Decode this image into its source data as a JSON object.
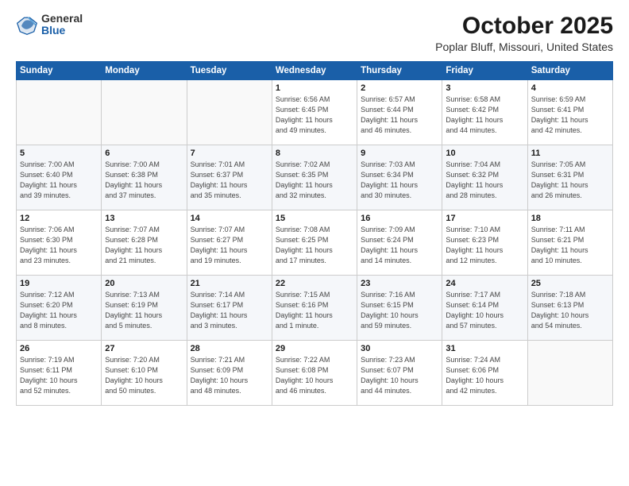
{
  "logo": {
    "general": "General",
    "blue": "Blue"
  },
  "title": "October 2025",
  "subtitle": "Poplar Bluff, Missouri, United States",
  "days_of_week": [
    "Sunday",
    "Monday",
    "Tuesday",
    "Wednesday",
    "Thursday",
    "Friday",
    "Saturday"
  ],
  "weeks": [
    [
      {
        "day": "",
        "info": ""
      },
      {
        "day": "",
        "info": ""
      },
      {
        "day": "",
        "info": ""
      },
      {
        "day": "1",
        "info": "Sunrise: 6:56 AM\nSunset: 6:45 PM\nDaylight: 11 hours\nand 49 minutes."
      },
      {
        "day": "2",
        "info": "Sunrise: 6:57 AM\nSunset: 6:44 PM\nDaylight: 11 hours\nand 46 minutes."
      },
      {
        "day": "3",
        "info": "Sunrise: 6:58 AM\nSunset: 6:42 PM\nDaylight: 11 hours\nand 44 minutes."
      },
      {
        "day": "4",
        "info": "Sunrise: 6:59 AM\nSunset: 6:41 PM\nDaylight: 11 hours\nand 42 minutes."
      }
    ],
    [
      {
        "day": "5",
        "info": "Sunrise: 7:00 AM\nSunset: 6:40 PM\nDaylight: 11 hours\nand 39 minutes."
      },
      {
        "day": "6",
        "info": "Sunrise: 7:00 AM\nSunset: 6:38 PM\nDaylight: 11 hours\nand 37 minutes."
      },
      {
        "day": "7",
        "info": "Sunrise: 7:01 AM\nSunset: 6:37 PM\nDaylight: 11 hours\nand 35 minutes."
      },
      {
        "day": "8",
        "info": "Sunrise: 7:02 AM\nSunset: 6:35 PM\nDaylight: 11 hours\nand 32 minutes."
      },
      {
        "day": "9",
        "info": "Sunrise: 7:03 AM\nSunset: 6:34 PM\nDaylight: 11 hours\nand 30 minutes."
      },
      {
        "day": "10",
        "info": "Sunrise: 7:04 AM\nSunset: 6:32 PM\nDaylight: 11 hours\nand 28 minutes."
      },
      {
        "day": "11",
        "info": "Sunrise: 7:05 AM\nSunset: 6:31 PM\nDaylight: 11 hours\nand 26 minutes."
      }
    ],
    [
      {
        "day": "12",
        "info": "Sunrise: 7:06 AM\nSunset: 6:30 PM\nDaylight: 11 hours\nand 23 minutes."
      },
      {
        "day": "13",
        "info": "Sunrise: 7:07 AM\nSunset: 6:28 PM\nDaylight: 11 hours\nand 21 minutes."
      },
      {
        "day": "14",
        "info": "Sunrise: 7:07 AM\nSunset: 6:27 PM\nDaylight: 11 hours\nand 19 minutes."
      },
      {
        "day": "15",
        "info": "Sunrise: 7:08 AM\nSunset: 6:25 PM\nDaylight: 11 hours\nand 17 minutes."
      },
      {
        "day": "16",
        "info": "Sunrise: 7:09 AM\nSunset: 6:24 PM\nDaylight: 11 hours\nand 14 minutes."
      },
      {
        "day": "17",
        "info": "Sunrise: 7:10 AM\nSunset: 6:23 PM\nDaylight: 11 hours\nand 12 minutes."
      },
      {
        "day": "18",
        "info": "Sunrise: 7:11 AM\nSunset: 6:21 PM\nDaylight: 11 hours\nand 10 minutes."
      }
    ],
    [
      {
        "day": "19",
        "info": "Sunrise: 7:12 AM\nSunset: 6:20 PM\nDaylight: 11 hours\nand 8 minutes."
      },
      {
        "day": "20",
        "info": "Sunrise: 7:13 AM\nSunset: 6:19 PM\nDaylight: 11 hours\nand 5 minutes."
      },
      {
        "day": "21",
        "info": "Sunrise: 7:14 AM\nSunset: 6:17 PM\nDaylight: 11 hours\nand 3 minutes."
      },
      {
        "day": "22",
        "info": "Sunrise: 7:15 AM\nSunset: 6:16 PM\nDaylight: 11 hours\nand 1 minute."
      },
      {
        "day": "23",
        "info": "Sunrise: 7:16 AM\nSunset: 6:15 PM\nDaylight: 10 hours\nand 59 minutes."
      },
      {
        "day": "24",
        "info": "Sunrise: 7:17 AM\nSunset: 6:14 PM\nDaylight: 10 hours\nand 57 minutes."
      },
      {
        "day": "25",
        "info": "Sunrise: 7:18 AM\nSunset: 6:13 PM\nDaylight: 10 hours\nand 54 minutes."
      }
    ],
    [
      {
        "day": "26",
        "info": "Sunrise: 7:19 AM\nSunset: 6:11 PM\nDaylight: 10 hours\nand 52 minutes."
      },
      {
        "day": "27",
        "info": "Sunrise: 7:20 AM\nSunset: 6:10 PM\nDaylight: 10 hours\nand 50 minutes."
      },
      {
        "day": "28",
        "info": "Sunrise: 7:21 AM\nSunset: 6:09 PM\nDaylight: 10 hours\nand 48 minutes."
      },
      {
        "day": "29",
        "info": "Sunrise: 7:22 AM\nSunset: 6:08 PM\nDaylight: 10 hours\nand 46 minutes."
      },
      {
        "day": "30",
        "info": "Sunrise: 7:23 AM\nSunset: 6:07 PM\nDaylight: 10 hours\nand 44 minutes."
      },
      {
        "day": "31",
        "info": "Sunrise: 7:24 AM\nSunset: 6:06 PM\nDaylight: 10 hours\nand 42 minutes."
      },
      {
        "day": "",
        "info": ""
      }
    ]
  ]
}
